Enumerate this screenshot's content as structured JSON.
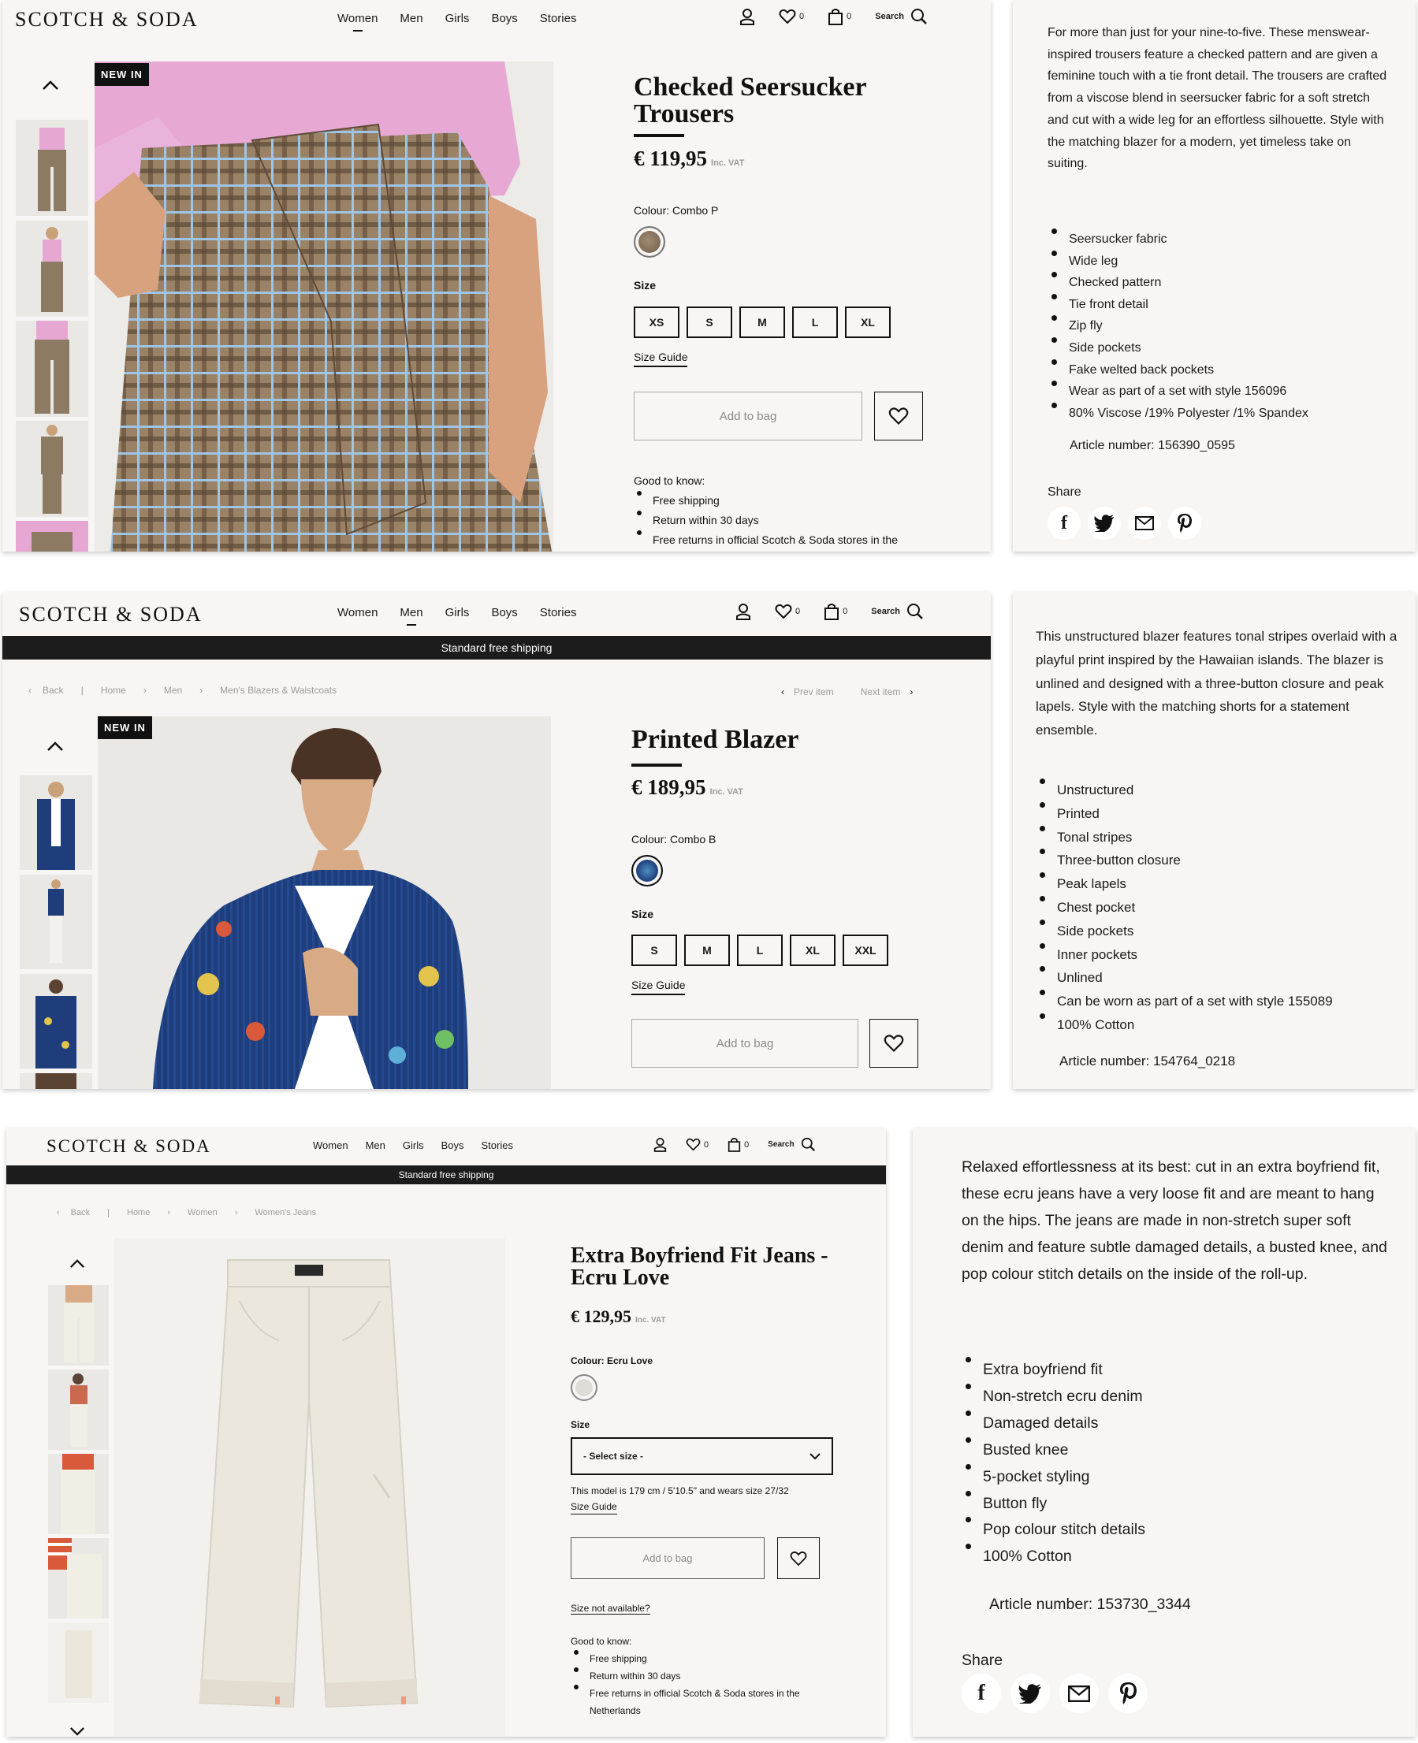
{
  "brand": "SCOTCH & SODA",
  "nav": [
    "Women",
    "Men",
    "Girls",
    "Boys",
    "Stories"
  ],
  "icons": {
    "account": "user-icon",
    "wishlist": "heart-icon",
    "bag": "bag-icon",
    "search": "search-icon"
  },
  "wishlist_count": "0",
  "bag_count": "0",
  "search_label": "Search",
  "inc_vat": "Inc. VAT",
  "size_label": "Size",
  "size_guide": "Size Guide",
  "add_to_bag": "Add to bag",
  "good_to_know": "Good to know:",
  "share_label": "Share",
  "share_icons": [
    "facebook-icon",
    "twitter-icon",
    "mail-icon",
    "pinterest-icon"
  ],
  "share_glyphs": [
    "f",
    "❧",
    "✉",
    "P"
  ],
  "panel1": {
    "badge": "NEW IN",
    "title": "Checked Seersucker Trousers",
    "price": "€ 119,95",
    "colour": "Colour: Combo P",
    "sizes": [
      "XS",
      "S",
      "M",
      "L",
      "XL"
    ],
    "good_to_know": [
      "Free shipping",
      "Return within 30 days",
      "Free returns in official Scotch & Soda stores in the"
    ],
    "description": "For more than just for your nine-to-five. These menswear-inspired trousers feature a checked pattern and are given a feminine touch with a tie front detail. The trousers are crafted from a viscose blend in seersucker fabric for a soft stretch and cut with a wide leg for an effortless silhouette. Style with the matching blazer for a modern, yet timeless take on suiting.",
    "features": [
      "Seersucker fabric",
      "Wide leg",
      "Checked pattern",
      "Tie front detail",
      "Zip fly",
      "Side pockets",
      "Fake welted back pockets",
      "Wear as part of a set with style 156096",
      "80% Viscose /19% Polyester /1% Spandex"
    ],
    "article": "Article number: 156390_0595"
  },
  "panel2": {
    "shipping": "Standard free shipping",
    "back": "Back",
    "breadcrumb": [
      "Home",
      "Men",
      "Men's Blazers & Waistcoats"
    ],
    "prev": "Prev item",
    "next": "Next item",
    "badge": "NEW IN",
    "title": "Printed Blazer",
    "price": "€ 189,95",
    "colour": "Colour: Combo B",
    "sizes": [
      "S",
      "M",
      "L",
      "XL",
      "XXL"
    ],
    "description": "This unstructured blazer features tonal stripes overlaid with a playful print inspired by the Hawaiian islands. The blazer is unlined and designed with a three-button closure and peak lapels. Style with the matching shorts for a statement ensemble.",
    "features": [
      "Unstructured",
      "Printed",
      "Tonal stripes",
      "Three-button closure",
      "Peak lapels",
      "Chest pocket",
      "Side pockets",
      "Inner pockets",
      "Unlined",
      "Can be worn as part of a set with style 155089",
      "100% Cotton"
    ],
    "article": "Article number: 154764_0218"
  },
  "panel3": {
    "shipping": "Standard free shipping",
    "back": "Back",
    "breadcrumb": [
      "Home",
      "Women",
      "Women's Jeans"
    ],
    "title": "Extra Boyfriend Fit Jeans - Ecru Love",
    "price": "€ 129,95",
    "colour": "Colour: Ecru Love",
    "select_size": "- Select size -",
    "model_note": "This model is 179 cm / 5'10.5\" and wears size 27/32",
    "size_not_available": "Size not available?",
    "good_to_know": [
      "Free shipping",
      "Return within 30 days",
      "Free returns in official Scotch & Soda stores in the Netherlands"
    ],
    "description": "Relaxed effortlessness at its best: cut in an extra boyfriend fit, these ecru jeans have a very loose fit and are meant to hang on the hips. The jeans are made in non-stretch super soft denim and feature subtle damaged details, a busted knee, and pop colour stitch details on the inside of the roll-up.",
    "features": [
      "Extra boyfriend fit",
      "Non-stretch ecru denim",
      "Damaged details",
      "Busted knee",
      "5-pocket styling",
      "Button fly",
      "Pop colour stitch details",
      "100% Cotton"
    ],
    "article": "Article number: 153730_3344"
  },
  "colors": {
    "accent": "#111111",
    "panel_bg": "#f7f6f4",
    "shipping_bar": "#1c1c1c",
    "muted": "#9b9b9b"
  }
}
